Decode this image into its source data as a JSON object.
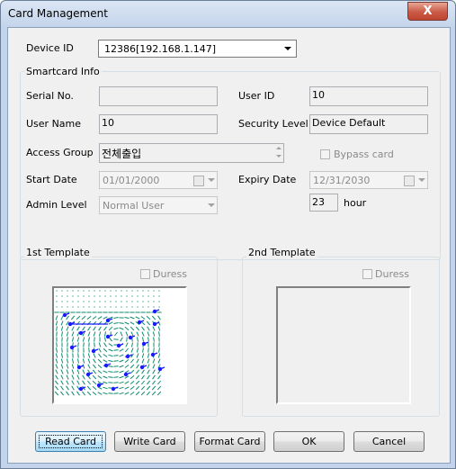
{
  "window": {
    "title": "Card Management",
    "close_symbol": "X"
  },
  "device": {
    "label": "Device ID",
    "value": "12386[192.168.1.147]"
  },
  "smartcard": {
    "group_title": "Smartcard Info",
    "serial_label": "Serial No.",
    "serial_value": "",
    "user_id_label": "User ID",
    "user_id_value": "10",
    "user_name_label": "User Name",
    "user_name_value": "10",
    "security_label": "Security Level",
    "security_value": "Device Default",
    "access_group_label": "Access Group",
    "access_group_value": "전체출입",
    "bypass_label": "Bypass card",
    "bypass_checked": false,
    "start_label": "Start Date",
    "start_value": "01/01/2000",
    "expiry_label": "Expiry Date",
    "expiry_value": "12/31/2030",
    "admin_label": "Admin Level",
    "admin_value": "Normal User",
    "hour_value": "23",
    "hour_label": "hour"
  },
  "template1": {
    "title": "1st Template",
    "duress_label": "Duress",
    "duress_checked": false,
    "has_image": true
  },
  "template2": {
    "title": "2nd Template",
    "duress_label": "Duress",
    "duress_checked": false,
    "has_image": false
  },
  "buttons": {
    "read_card": "Read Card",
    "write_card": "Write Card",
    "format_card": "Format Card",
    "ok": "OK",
    "cancel": "Cancel"
  },
  "colors": {
    "fingerprint_lines": "#0b8a6e",
    "minutiae": "#1a1aff"
  }
}
